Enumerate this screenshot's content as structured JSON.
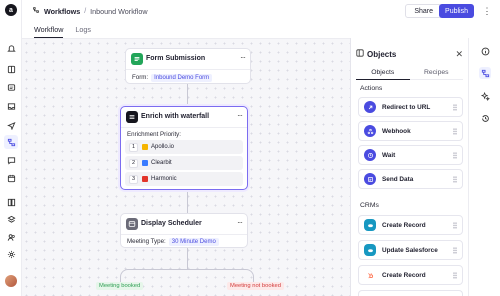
{
  "header": {
    "breadcrumb_root": "Workflows",
    "breadcrumb_separator": "/",
    "breadcrumb_current": "Inbound Workflow",
    "share_label": "Share",
    "publish_label": "Publish",
    "more_label": "⋮"
  },
  "tabs": [
    {
      "label": "Workflow",
      "active": true
    },
    {
      "label": "Logs",
      "active": false
    }
  ],
  "logo_text": "a",
  "left_rail_icons": [
    "bell-icon",
    "book-icon",
    "list-icon",
    "inbox-icon",
    "send-icon",
    "database-icon",
    "workflow-icon",
    "chat-icon",
    "calendar-icon",
    "library-icon",
    "layers-icon",
    "people-icon",
    "settings-icon"
  ],
  "canvas": {
    "form_node": {
      "title": "Form Submission",
      "field_label": "Form:",
      "field_value": "Inbound Demo Form",
      "kebab": "···"
    },
    "enrich_node": {
      "title": "Enrich with waterfall",
      "kebab": "···",
      "priority_label": "Enrichment Priority:",
      "providers": [
        {
          "num": "1",
          "name": "Apollo.io",
          "color": "#f5b400"
        },
        {
          "num": "2",
          "name": "Clearbit",
          "color": "#3a7bff"
        },
        {
          "num": "3",
          "name": "Harmonic",
          "color": "#e2352b"
        }
      ]
    },
    "scheduler_node": {
      "title": "Display Scheduler",
      "field_label": "Meeting Type:",
      "field_value": "30 Minute Demo",
      "kebab": "···"
    },
    "branches": [
      {
        "label": "Meeting booked",
        "color": "#2f9e54",
        "bg": "#e6f6ea"
      },
      {
        "label": "Meeting not booked",
        "color": "#d23b3b",
        "bg": "#fde9e9"
      }
    ]
  },
  "panel": {
    "title": "Objects",
    "close": "✕",
    "tabs": [
      {
        "label": "Objects",
        "active": true
      },
      {
        "label": "Recipes",
        "active": false
      }
    ],
    "actions_heading": "Actions",
    "actions": [
      {
        "label": "Redirect to URL",
        "icon": "redirect-icon",
        "color": "#4a4be0"
      },
      {
        "label": "Webhook",
        "icon": "webhook-icon",
        "color": "#4a4be0"
      },
      {
        "label": "Wait",
        "icon": "clock-icon",
        "color": "#4a4be0"
      },
      {
        "label": "Send Data",
        "icon": "send-data-icon",
        "color": "#4a4be0"
      }
    ],
    "crms_heading": "CRMs",
    "crms": [
      {
        "label": "Create Record",
        "icon": "salesforce-icon",
        "color": "#1798c1"
      },
      {
        "label": "Update Salesforce",
        "icon": "salesforce-icon",
        "color": "#1798c1"
      },
      {
        "label": "Create Record",
        "icon": "hubspot-icon",
        "color": "#ff7a59"
      }
    ]
  },
  "right_rail_icons": [
    "info-icon",
    "workflow-objects-icon",
    "sparkle-icon",
    "history-icon"
  ]
}
